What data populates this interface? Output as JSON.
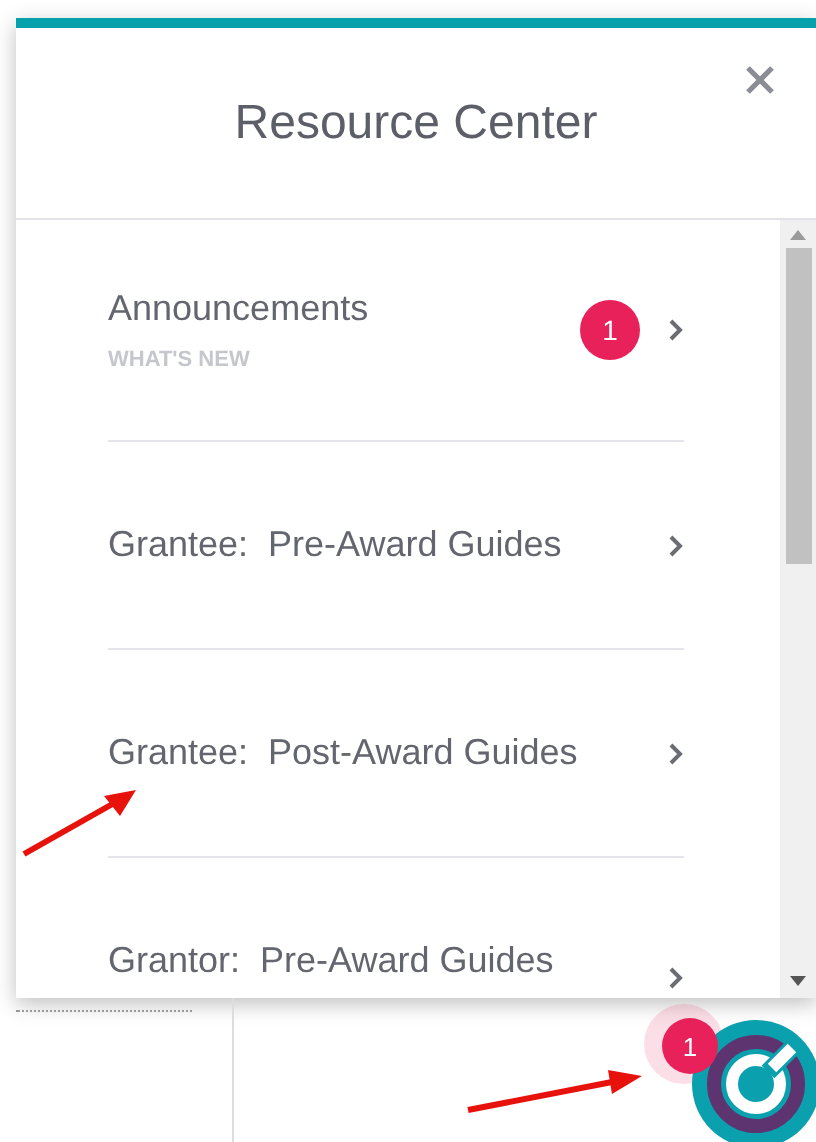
{
  "panel": {
    "title": "Resource Center"
  },
  "items": [
    {
      "title": "Announcements",
      "subtitle": "WHAT'S NEW",
      "badge": "1"
    },
    {
      "title": "Grantee:  Pre-Award Guides"
    },
    {
      "title": "Grantee:  Post-Award Guides"
    },
    {
      "title": "Grantor:  Pre-Award Guides"
    }
  ],
  "launcher": {
    "badge": "1"
  }
}
